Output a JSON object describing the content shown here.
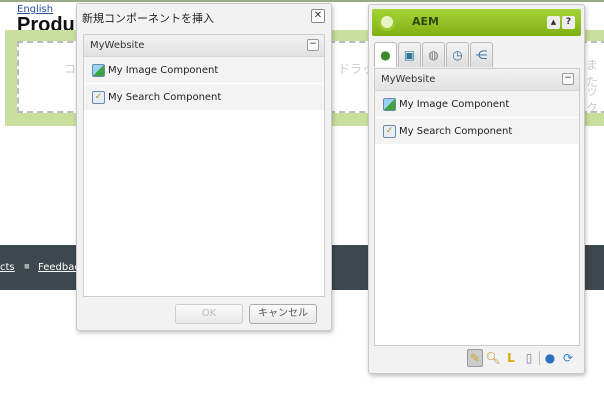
{
  "page": {
    "language_link": "English",
    "heading": "Produ",
    "placeholder_left": "コ",
    "placeholder_mid": "ドラッ",
    "placeholder_right1": "また",
    "placeholder_right2": "ック",
    "footer_links": [
      "cts",
      "Feedbac"
    ],
    "footer_sep": "■"
  },
  "insert_dialog": {
    "title": "新規コンポーネントを挿入",
    "close": "✕",
    "group": "MyWebsite",
    "collapse": "−",
    "items": [
      "My Image Component",
      "My Search Component"
    ],
    "ok_label": "OK",
    "cancel_label": "キャンセル"
  },
  "sidekick": {
    "title": "AEM",
    "up": "▲",
    "help": "?",
    "group": "MyWebsite",
    "collapse": "−",
    "items": [
      "My Image Component",
      "My Search Component"
    ],
    "accent": "#8cbf1a"
  }
}
